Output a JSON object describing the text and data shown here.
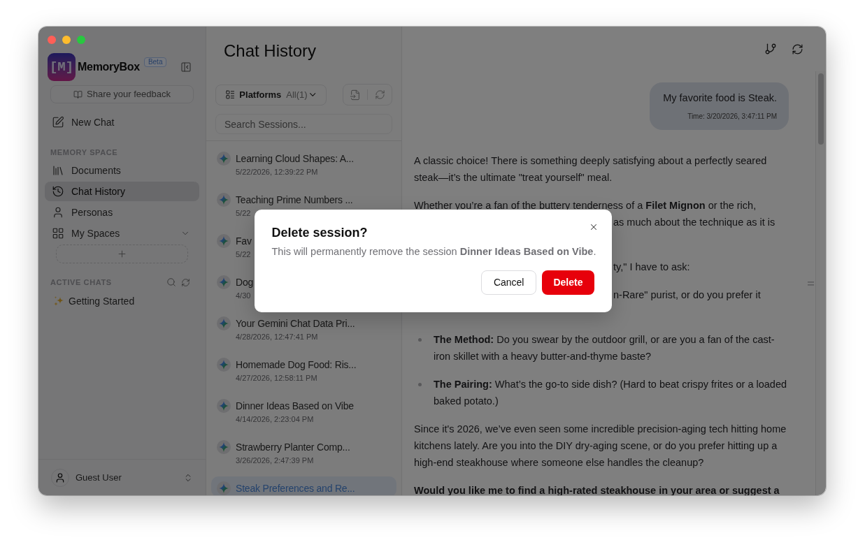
{
  "sidebar": {
    "logo_mark": "[M]",
    "app_name": "MemoryBox",
    "badge": "Beta",
    "feedback_button": "Share your feedback",
    "new_chat": "New Chat",
    "memory_space": {
      "heading": "MEMORY SPACE",
      "items": [
        {
          "label": "Documents",
          "selected": false
        },
        {
          "label": "Chat History",
          "selected": true
        },
        {
          "label": "Personas",
          "selected": false
        }
      ]
    },
    "my_spaces": {
      "label": "My Spaces",
      "expanded": true
    },
    "active_chats": {
      "heading": "ACTIVE CHATS",
      "items": [
        {
          "label": "Getting Started"
        }
      ]
    },
    "user": {
      "name": "Guest User"
    }
  },
  "history": {
    "title": "Chat History",
    "filter": {
      "label": "Platforms",
      "value": "All(1)"
    },
    "search": {
      "placeholder": "Search Sessions..."
    },
    "sessions": [
      {
        "title": "Learning Cloud Shapes: A...",
        "date": "5/22/2026, 12:39:22 PM",
        "selected": false
      },
      {
        "title": "Teaching Prime Numbers ...",
        "date": "5/22",
        "selected": false
      },
      {
        "title": "Fav",
        "date": "5/22",
        "selected": false
      },
      {
        "title": "Dog",
        "date": "4/30",
        "selected": false
      },
      {
        "title": "Your Gemini Chat Data Pri...",
        "date": "4/28/2026, 12:47:41 PM",
        "selected": false
      },
      {
        "title": "Homemade Dog Food: Ris...",
        "date": "4/27/2026, 12:58:11 PM",
        "selected": false
      },
      {
        "title": "Dinner Ideas Based on Vibe",
        "date": "4/14/2026, 2:23:04 PM",
        "selected": false
      },
      {
        "title": "Strawberry Planter Comp...",
        "date": "3/26/2026, 2:47:39 PM",
        "selected": false
      },
      {
        "title": "Steak Preferences and Re...",
        "selected": true
      }
    ]
  },
  "chat": {
    "messages": [
      {
        "kind": "user",
        "text": "My favorite food is Steak.",
        "time": "Time: 3/20/2026, 3:47:11 PM"
      },
      {
        "kind": "assistant",
        "blocks": [
          {
            "kind": "paragraph",
            "bold": false,
            "text": "A classic choice! There is something deeply satisfying about a perfectly seared steak—it’s the ultimate \"treat yourself\" meal."
          },
          {
            "kind": "lines",
            "lines": [
              {
                "text": "Whether you’re a fan of the buttery tenderness of a **Filet Mignon** or the rich,",
                "covered": false
              },
              {
                "text": "as much about the technique as it is",
                "covered": true
              }
            ]
          },
          {
            "kind": "lines",
            "lines": [
              {
                "text": "ty,\" I have to ask:",
                "covered": true
              }
            ]
          },
          {
            "kind": "list",
            "items": [
              {
                "lines": [
                  {
                    "text": "n-Rare\" purist, or do you prefer it",
                    "covered": true
                  }
                ]
              },
              {
                "text": "**The Method:** Do you swear by the outdoor grill, or are you a fan of the cast-iron skillet with a heavy butter-and-thyme baste?"
              },
              {
                "text": "**The Pairing:** What’s the go-to side dish? (Hard to beat crispy frites or a loaded baked potato.)"
              }
            ]
          },
          {
            "kind": "paragraph",
            "bold": false,
            "text": "Since it's 2026, we’ve even seen some incredible precision-aging tech hitting home kitchens lately. Are you into the DIY dry-aging scene, or do you prefer hitting up a high-end steakhouse where someone else handles the cleanup?"
          },
          {
            "kind": "paragraph",
            "bold": true,
            "text": "Would you like me to find a high-rated steakhouse in your area or suggest a"
          }
        ]
      }
    ]
  },
  "dialog": {
    "title": "Delete session?",
    "body": "This will permanently remove the session **Dinner Ideas Based on Vibe**.",
    "buttons": [
      {
        "label": "Cancel",
        "kind": "secondary"
      },
      {
        "label": "Delete",
        "kind": "danger"
      }
    ]
  }
}
